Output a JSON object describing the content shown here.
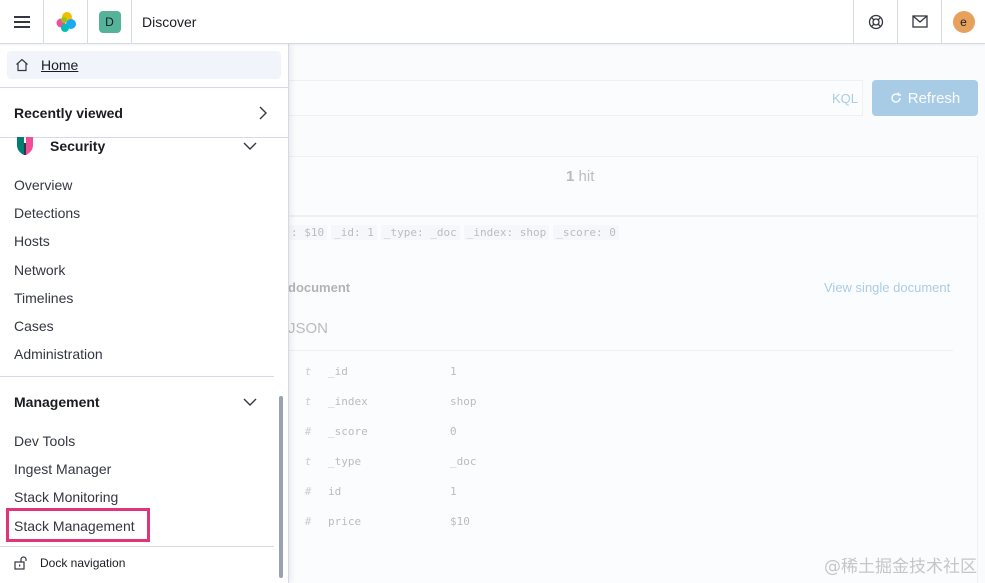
{
  "header": {
    "space_initial": "D",
    "title": "Discover",
    "user_initial": "e",
    "icons": [
      "menu-icon",
      "elastic-logo-icon",
      "help-icon",
      "mail-icon"
    ]
  },
  "nav": {
    "home_label": "Home",
    "recently_viewed": "Recently viewed",
    "security": {
      "title": "Security",
      "items": [
        "Overview",
        "Detections",
        "Hosts",
        "Network",
        "Timelines",
        "Cases",
        "Administration"
      ]
    },
    "management": {
      "title": "Management",
      "items": [
        "Dev Tools",
        "Ingest Manager",
        "Stack Monitoring",
        "Stack Management"
      ]
    },
    "dock_label": "Dock navigation"
  },
  "background": {
    "kql": "KQL",
    "refresh": "Refresh",
    "hits_count": "1",
    "hits_label": "hit",
    "row_fields": [
      ": $10",
      "_id: 1",
      "_type: _doc",
      "_index: shop",
      "_score: 0"
    ],
    "expanded_label": "document",
    "view_single": "View single document",
    "json_tab": "JSON",
    "fields": [
      {
        "type": "t",
        "name": "_id",
        "value": "1"
      },
      {
        "type": "t",
        "name": "_index",
        "value": "shop"
      },
      {
        "type": "#",
        "name": "_score",
        "value": "0"
      },
      {
        "type": "t",
        "name": "_type",
        "value": "_doc"
      },
      {
        "type": "#",
        "name": "id",
        "value": "1"
      },
      {
        "type": "#",
        "name": "price",
        "value": "$10"
      }
    ]
  },
  "watermark": "@稀土掘金技术社区",
  "colors": {
    "accent": "#006bb4",
    "highlight": "#e0357b",
    "space_badge": "#54b399",
    "avatar": "#e7a15d"
  }
}
